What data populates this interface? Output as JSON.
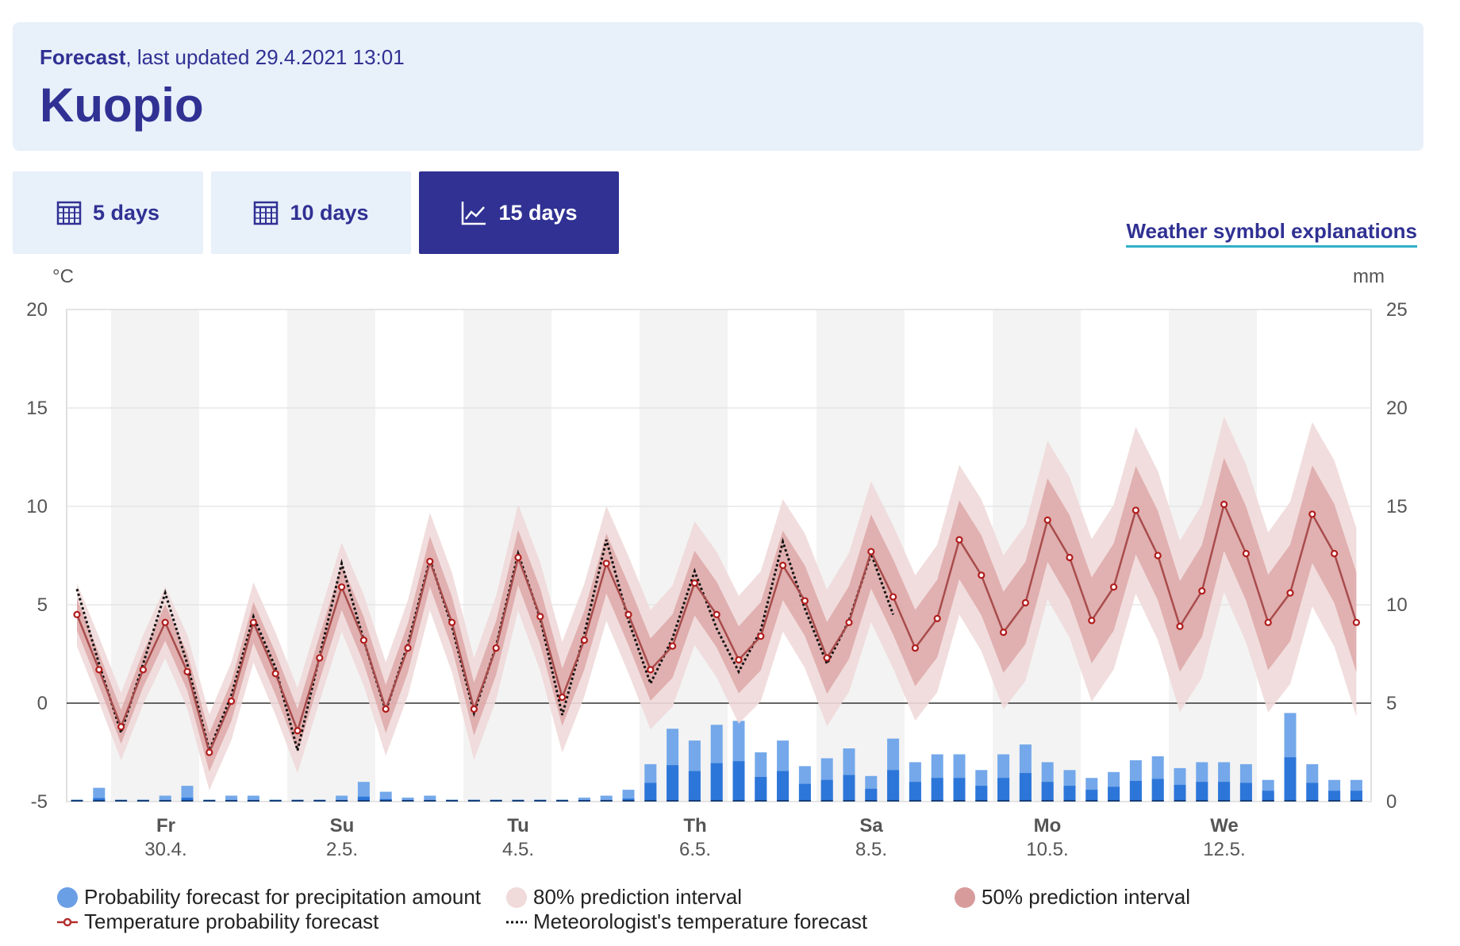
{
  "header": {
    "label_bold": "Forecast",
    "label_rest": ", last updated 29.4.2021 13:01",
    "city": "Kuopio"
  },
  "tabs": [
    {
      "label": "5 days",
      "icon": "calendar-icon",
      "active": false
    },
    {
      "label": "10 days",
      "icon": "calendar-icon",
      "active": false
    },
    {
      "label": "15 days",
      "icon": "line-chart-icon",
      "active": true
    }
  ],
  "symbol_link": "Weather symbol explanations",
  "colors": {
    "primary": "#303193",
    "header_bg": "#e8f0fa",
    "link_underline": "#2fb0c6",
    "temp_line": "#a84c4c",
    "band80": "#efd9d9",
    "band50": "#dba0a0",
    "precip_light": "#74a8ea",
    "precip_mid": "#2d76d9",
    "precip_dark": "#173f7a",
    "meteorologist_line": "#111111"
  },
  "chart_data": {
    "type": "line",
    "left_unit": "°C",
    "right_unit": "mm",
    "left_ylim": [
      -5,
      20
    ],
    "left_ticks": [
      "20",
      "15",
      "10",
      "5",
      "0",
      "-5"
    ],
    "right_ylim": [
      0,
      25
    ],
    "right_ticks": [
      "25",
      "20",
      "15",
      "10",
      "5",
      "0"
    ],
    "day_labels": [
      {
        "name": "Fr",
        "date": "30.4."
      },
      {
        "name": "Su",
        "date": "2.5."
      },
      {
        "name": "Tu",
        "date": "4.5."
      },
      {
        "name": "Th",
        "date": "6.5."
      },
      {
        "name": "Sa",
        "date": "8.5."
      },
      {
        "name": "Mo",
        "date": "10.5."
      },
      {
        "name": "We",
        "date": "12.5."
      }
    ],
    "temperature_probability": [
      4.5,
      1.7,
      -1.2,
      1.7,
      4.1,
      1.6,
      -2.5,
      0.1,
      4.1,
      1.5,
      -1.4,
      2.3,
      5.9,
      3.2,
      -0.3,
      2.8,
      7.2,
      4.1,
      -0.3,
      2.8,
      7.4,
      4.4,
      0.3,
      3.2,
      7.1,
      4.5,
      1.7,
      2.9,
      6.1,
      4.5,
      2.2,
      3.4,
      7.0,
      5.2,
      2.3,
      4.1,
      7.7,
      5.4,
      2.8,
      4.3,
      8.3,
      6.5,
      3.6,
      5.1,
      9.3,
      7.4,
      4.2,
      5.9,
      9.8,
      7.5,
      3.9,
      5.7,
      10.1,
      7.6,
      4.1,
      5.6,
      9.6,
      7.6,
      4.1
    ],
    "meteorologist_forecast": [
      5.8,
      2.0,
      -1.5,
      2.0,
      5.6,
      2.0,
      -2.4,
      0.4,
      4.4,
      1.8,
      -2.4,
      2.4,
      7.1,
      3.2,
      -0.4,
      3.0,
      7.3,
      3.9,
      -0.5,
      2.9,
      7.6,
      4.3,
      -0.6,
      3.5,
      8.3,
      4.2,
      1.0,
      3.3,
      6.7,
      3.8,
      1.6,
      3.7,
      8.2,
      4.8,
      2.0,
      4.2,
      7.6,
      4.5
    ]
  },
  "legend": [
    {
      "label": "Probability forecast for precipitation amount",
      "kind": "dot",
      "color": "#6a9fe6"
    },
    {
      "label": "80% prediction interval",
      "kind": "dot",
      "color": "#f0dada"
    },
    {
      "label": "50% prediction interval",
      "kind": "dot",
      "color": "#d89b9b"
    },
    {
      "label": "Temperature probability forecast",
      "kind": "line-dot",
      "color": "#b23030"
    },
    {
      "label": "Meteorologist's temperature forecast",
      "kind": "dotted",
      "color": "#111111"
    }
  ]
}
